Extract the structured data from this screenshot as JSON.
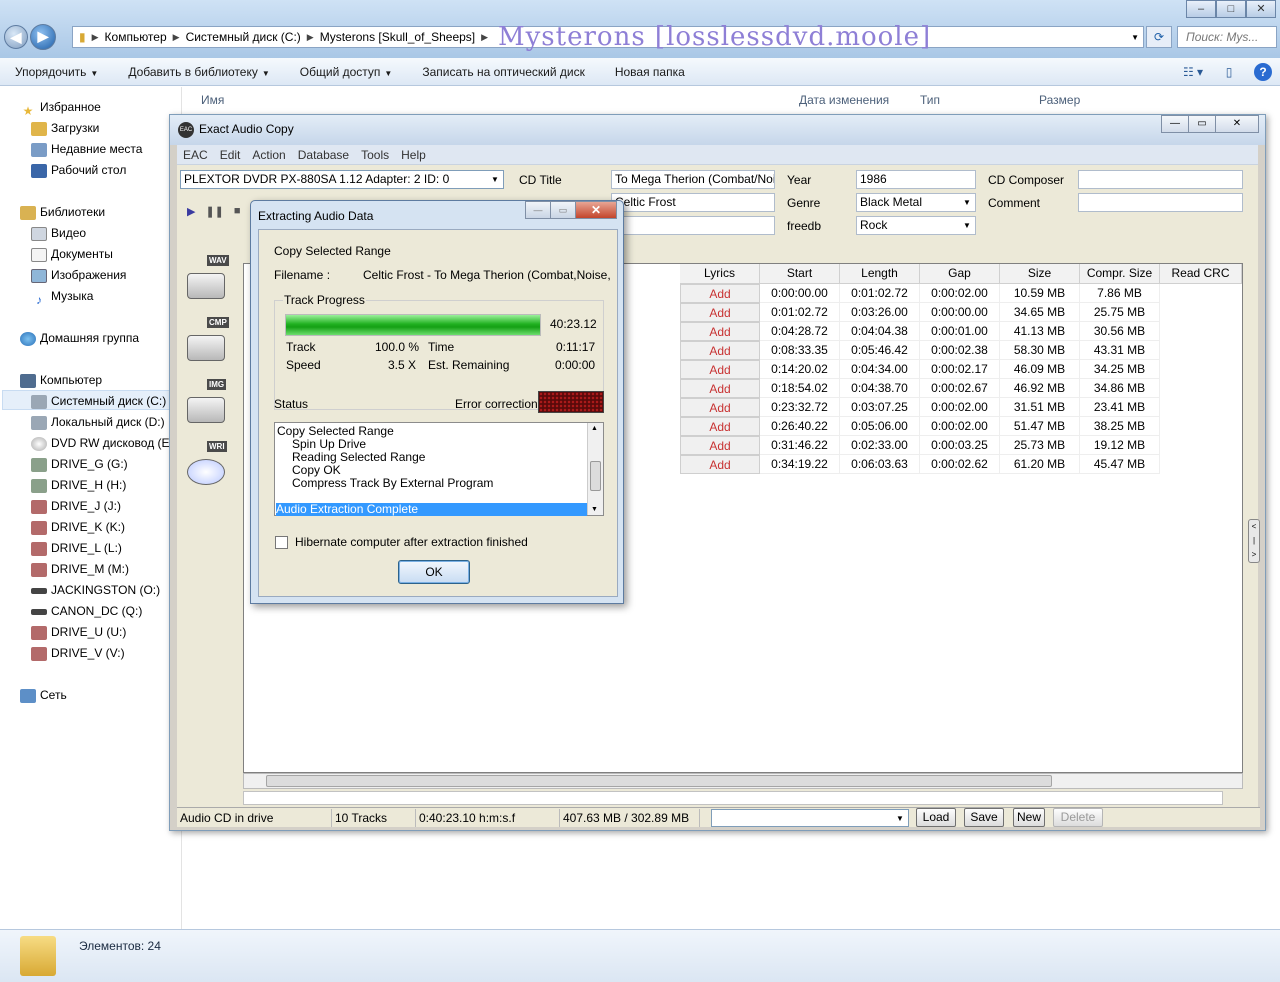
{
  "explorer": {
    "nav": {
      "back": "◀",
      "forward": "▶"
    },
    "breadcrumbs": [
      "Компьютер",
      "Системный диск (C:)",
      "Mysterons [Skull_of_Sheeps]"
    ],
    "watermark": "Mysterons [losslessdvd.moole]",
    "search_placeholder": "Поиск: Mys...",
    "commands": [
      "Упорядочить",
      "Добавить в библиотеку",
      "Общий доступ",
      "Записать на оптический диск",
      "Новая папка"
    ],
    "columns": {
      "name": "Имя",
      "date": "Дата изменения",
      "type": "Тип",
      "size": "Размер"
    },
    "nav_groups": {
      "favorites": "Избранное",
      "favorites_items": [
        "Загрузки",
        "Недавние места",
        "Рабочий стол"
      ],
      "libraries": "Библиотеки",
      "libraries_items": [
        "Видео",
        "Документы",
        "Изображения",
        "Музыка"
      ],
      "homegroup": "Домашняя группа",
      "computer": "Компьютер",
      "computer_items": [
        "Системный диск (C:)",
        "Локальный диск (D:)",
        "DVD RW дисковод (E:)",
        "DRIVE_G (G:)",
        "DRIVE_H (H:)",
        "DRIVE_J (J:)",
        "DRIVE_K (K:)",
        "DRIVE_L (L:)",
        "DRIVE_M (M:)",
        "JACKINGSTON (O:)",
        "CANON_DC (Q:)",
        "DRIVE_U (U:)",
        "DRIVE_V (V:)"
      ],
      "network": "Сеть"
    },
    "status": "Элементов: 24"
  },
  "eac": {
    "title": "Exact Audio Copy",
    "menu": [
      "EAC",
      "Edit",
      "Action",
      "Database",
      "Tools",
      "Help"
    ],
    "drive": "PLEXTOR DVDR   PX-880SA 1.12   Adapter: 2  ID: 0",
    "labels": {
      "cd_title": "CD Title",
      "year": "Year",
      "cd_composer": "CD Composer",
      "genre": "Genre",
      "comment": "Comment",
      "freedb": "freedb"
    },
    "values": {
      "cd_title": "To Mega Therion (Combat/Noise,",
      "artist": "Celtic Frost",
      "year": "1986",
      "genre": "Black Metal",
      "freedb": "Rock"
    },
    "side_icons": [
      "WAV",
      "CMP",
      "IMG",
      "WRI"
    ],
    "table_headers": [
      "Lyrics",
      "Start",
      "Length",
      "Gap",
      "Size",
      "Compr. Size",
      "Read CRC"
    ],
    "tracks": [
      [
        "Add",
        "0:00:00.00",
        "0:01:02.72",
        "0:00:02.00",
        "10.59 MB",
        "7.86 MB"
      ],
      [
        "Add",
        "0:01:02.72",
        "0:03:26.00",
        "0:00:00.00",
        "34.65 MB",
        "25.75 MB"
      ],
      [
        "Add",
        "0:04:28.72",
        "0:04:04.38",
        "0:00:01.00",
        "41.13 MB",
        "30.56 MB"
      ],
      [
        "Add",
        "0:08:33.35",
        "0:05:46.42",
        "0:00:02.38",
        "58.30 MB",
        "43.31 MB"
      ],
      [
        "Add",
        "0:14:20.02",
        "0:04:34.00",
        "0:00:02.17",
        "46.09 MB",
        "34.25 MB"
      ],
      [
        "Add",
        "0:18:54.02",
        "0:04:38.70",
        "0:00:02.67",
        "46.92 MB",
        "34.86 MB"
      ],
      [
        "Add",
        "0:23:32.72",
        "0:03:07.25",
        "0:00:02.00",
        "31.51 MB",
        "23.41 MB"
      ],
      [
        "Add",
        "0:26:40.22",
        "0:05:06.00",
        "0:00:02.00",
        "51.47 MB",
        "38.25 MB"
      ],
      [
        "Add",
        "0:31:46.22",
        "0:02:33.00",
        "0:00:03.25",
        "25.73 MB",
        "19.12 MB"
      ],
      [
        "Add",
        "0:34:19.22",
        "0:06:03.63",
        "0:00:02.62",
        "61.20 MB",
        "45.47 MB"
      ]
    ],
    "bottom": {
      "status": "Audio CD in drive",
      "tracks": "10 Tracks",
      "length": "0:40:23.10 h:m:s.f",
      "size": "407.63 MB / 302.89 MB",
      "load": "Load",
      "save": "Save",
      "new": "New",
      "delete": "Delete"
    }
  },
  "dialog": {
    "title": "Extracting Audio Data",
    "mode": "Copy Selected Range",
    "filename_label": "Filename :",
    "filename": "Celtic Frost - To Mega Therion (Combat,Noise,",
    "track_progress_label": "Track Progress",
    "progress_value": "40:23.12",
    "progress_fraction": 1.0,
    "track_label": "Track",
    "track_pct": "100.0 %",
    "time_label": "Time",
    "time_value": "0:11:17",
    "speed_label": "Speed",
    "speed_value": "3.5 X",
    "remaining_label": "Est. Remaining",
    "remaining_value": "0:00:00",
    "status_label": "Status",
    "error_label": "Error correction :",
    "log": [
      "Copy Selected Range",
      "Spin Up Drive",
      "Reading Selected Range",
      "Copy OK",
      "Compress Track By External Program",
      "Audio Extraction Complete"
    ],
    "hibernate": "Hibernate computer after extraction finished",
    "ok": "OK"
  }
}
